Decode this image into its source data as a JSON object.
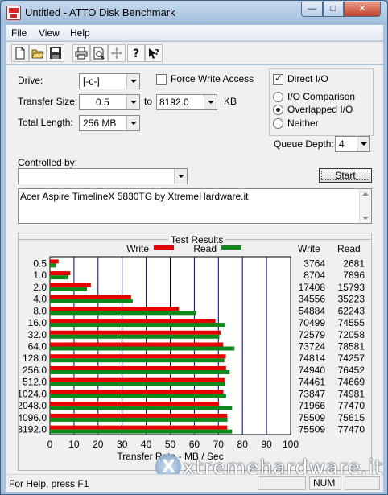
{
  "window": {
    "title": "Untitled - ATTO Disk Benchmark",
    "min_glyph": "—",
    "max_glyph": "□",
    "close_glyph": "✕"
  },
  "menu": [
    "File",
    "View",
    "Help"
  ],
  "toolbar": [
    "new-icon",
    "open-icon",
    "save-icon",
    "print-icon",
    "print-preview-icon",
    "move-icon",
    "help-icon",
    "context-help-icon"
  ],
  "form": {
    "drive_label": "Drive:",
    "drive_value": "[-c-]",
    "force_write_label": "Force Write Access",
    "force_write_checked": false,
    "direct_io_label": "Direct I/O",
    "direct_io_checked": true,
    "transfer_size_label": "Transfer Size:",
    "transfer_from": "0.5",
    "to_label": "to",
    "transfer_to": "8192.0",
    "kb_label": "KB",
    "total_length_label": "Total Length:",
    "total_length_value": "256 MB",
    "io_comparison_label": "I/O Comparison",
    "overlapped_io_label": "Overlapped I/O",
    "neither_label": "Neither",
    "selected_mode": "overlapped",
    "queue_depth_label": "Queue Depth:",
    "queue_depth_value": "4",
    "controlled_by_label": "Controlled by:",
    "controlled_by_value": "",
    "start_label": "Start",
    "description": "Acer Aspire TimelineX 5830TG by XtremeHardware.it"
  },
  "results": {
    "title": "Test Results",
    "legend_write": "Write",
    "legend_read": "Read",
    "col_write": "Write",
    "col_read": "Read",
    "xlabel": "Transfer Rate - MB / Sec",
    "colors": {
      "write": "#e80000",
      "read": "#0e8a1c",
      "grid": "#000080"
    }
  },
  "chart_data": {
    "type": "bar",
    "orientation": "horizontal",
    "title": "Test Results",
    "xlabel": "Transfer Rate - MB / Sec",
    "xlim": [
      0,
      100
    ],
    "xticks": [
      0,
      10,
      20,
      30,
      40,
      50,
      60,
      70,
      80,
      90,
      100
    ],
    "categories": [
      "0.5",
      "1.0",
      "2.0",
      "4.0",
      "8.0",
      "16.0",
      "32.0",
      "64.0",
      "128.0",
      "256.0",
      "512.0",
      "1024.0",
      "2048.0",
      "4096.0",
      "8192.0"
    ],
    "series": [
      {
        "name": "Write",
        "color": "#e80000",
        "values": [
          3.6,
          8.5,
          17.0,
          33.7,
          53.6,
          68.8,
          70.9,
          72.0,
          73.1,
          73.2,
          72.7,
          72.1,
          70.3,
          73.7,
          73.7
        ],
        "labels": [
          "3764",
          "8704",
          "17408",
          "34556",
          "54884",
          "70499",
          "72579",
          "73724",
          "74814",
          "74940",
          "74461",
          "73847",
          "71966",
          "75509",
          "75509"
        ]
      },
      {
        "name": "Read",
        "color": "#0e8a1c",
        "values": [
          2.6,
          7.7,
          15.4,
          34.4,
          60.8,
          72.8,
          70.4,
          76.7,
          72.5,
          74.7,
          72.9,
          73.2,
          75.7,
          73.8,
          75.7
        ],
        "labels": [
          "2681",
          "7896",
          "15793",
          "35223",
          "62243",
          "74555",
          "72058",
          "78581",
          "74257",
          "76452",
          "74669",
          "74981",
          "77470",
          "75615",
          "77470"
        ]
      }
    ],
    "grid": true,
    "legend": "top"
  },
  "watermark": "xtremehardware.it",
  "status": {
    "text": "For Help, press F1",
    "num": "NUM"
  }
}
